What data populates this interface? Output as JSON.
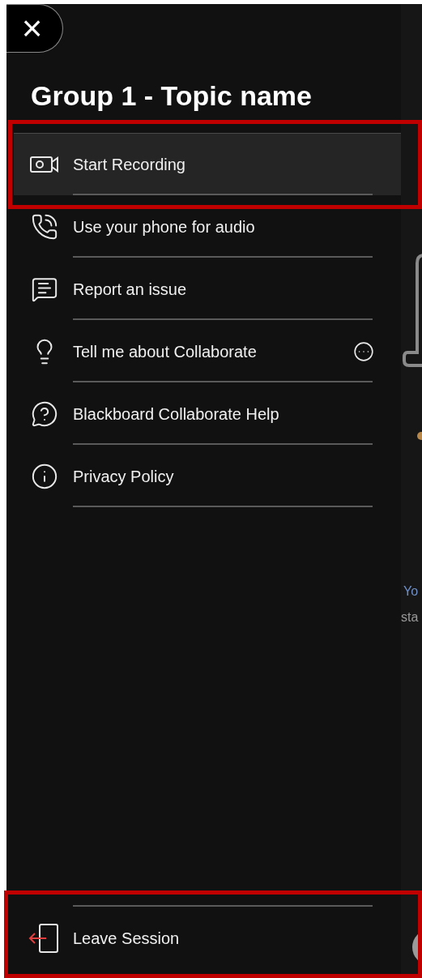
{
  "close_button": {
    "label": "×"
  },
  "title": "Group 1 - Topic name",
  "menu": [
    {
      "kind": "record",
      "label": "Start Recording",
      "selected": true,
      "highlighted": true
    },
    {
      "kind": "phone",
      "label": "Use your phone for audio",
      "selected": false,
      "highlighted": false
    },
    {
      "kind": "report",
      "label": "Report an issue",
      "selected": false,
      "highlighted": false
    },
    {
      "kind": "tips",
      "label": "Tell me about Collaborate",
      "selected": false,
      "highlighted": false,
      "more": true
    },
    {
      "kind": "help",
      "label": "Blackboard Collaborate Help",
      "selected": false,
      "highlighted": false
    },
    {
      "kind": "privacy",
      "label": "Privacy Policy",
      "selected": false,
      "highlighted": false
    }
  ],
  "leave_session": {
    "label": "Leave Session",
    "highlighted": true
  },
  "background_text": [
    "Yo",
    "sta"
  ]
}
